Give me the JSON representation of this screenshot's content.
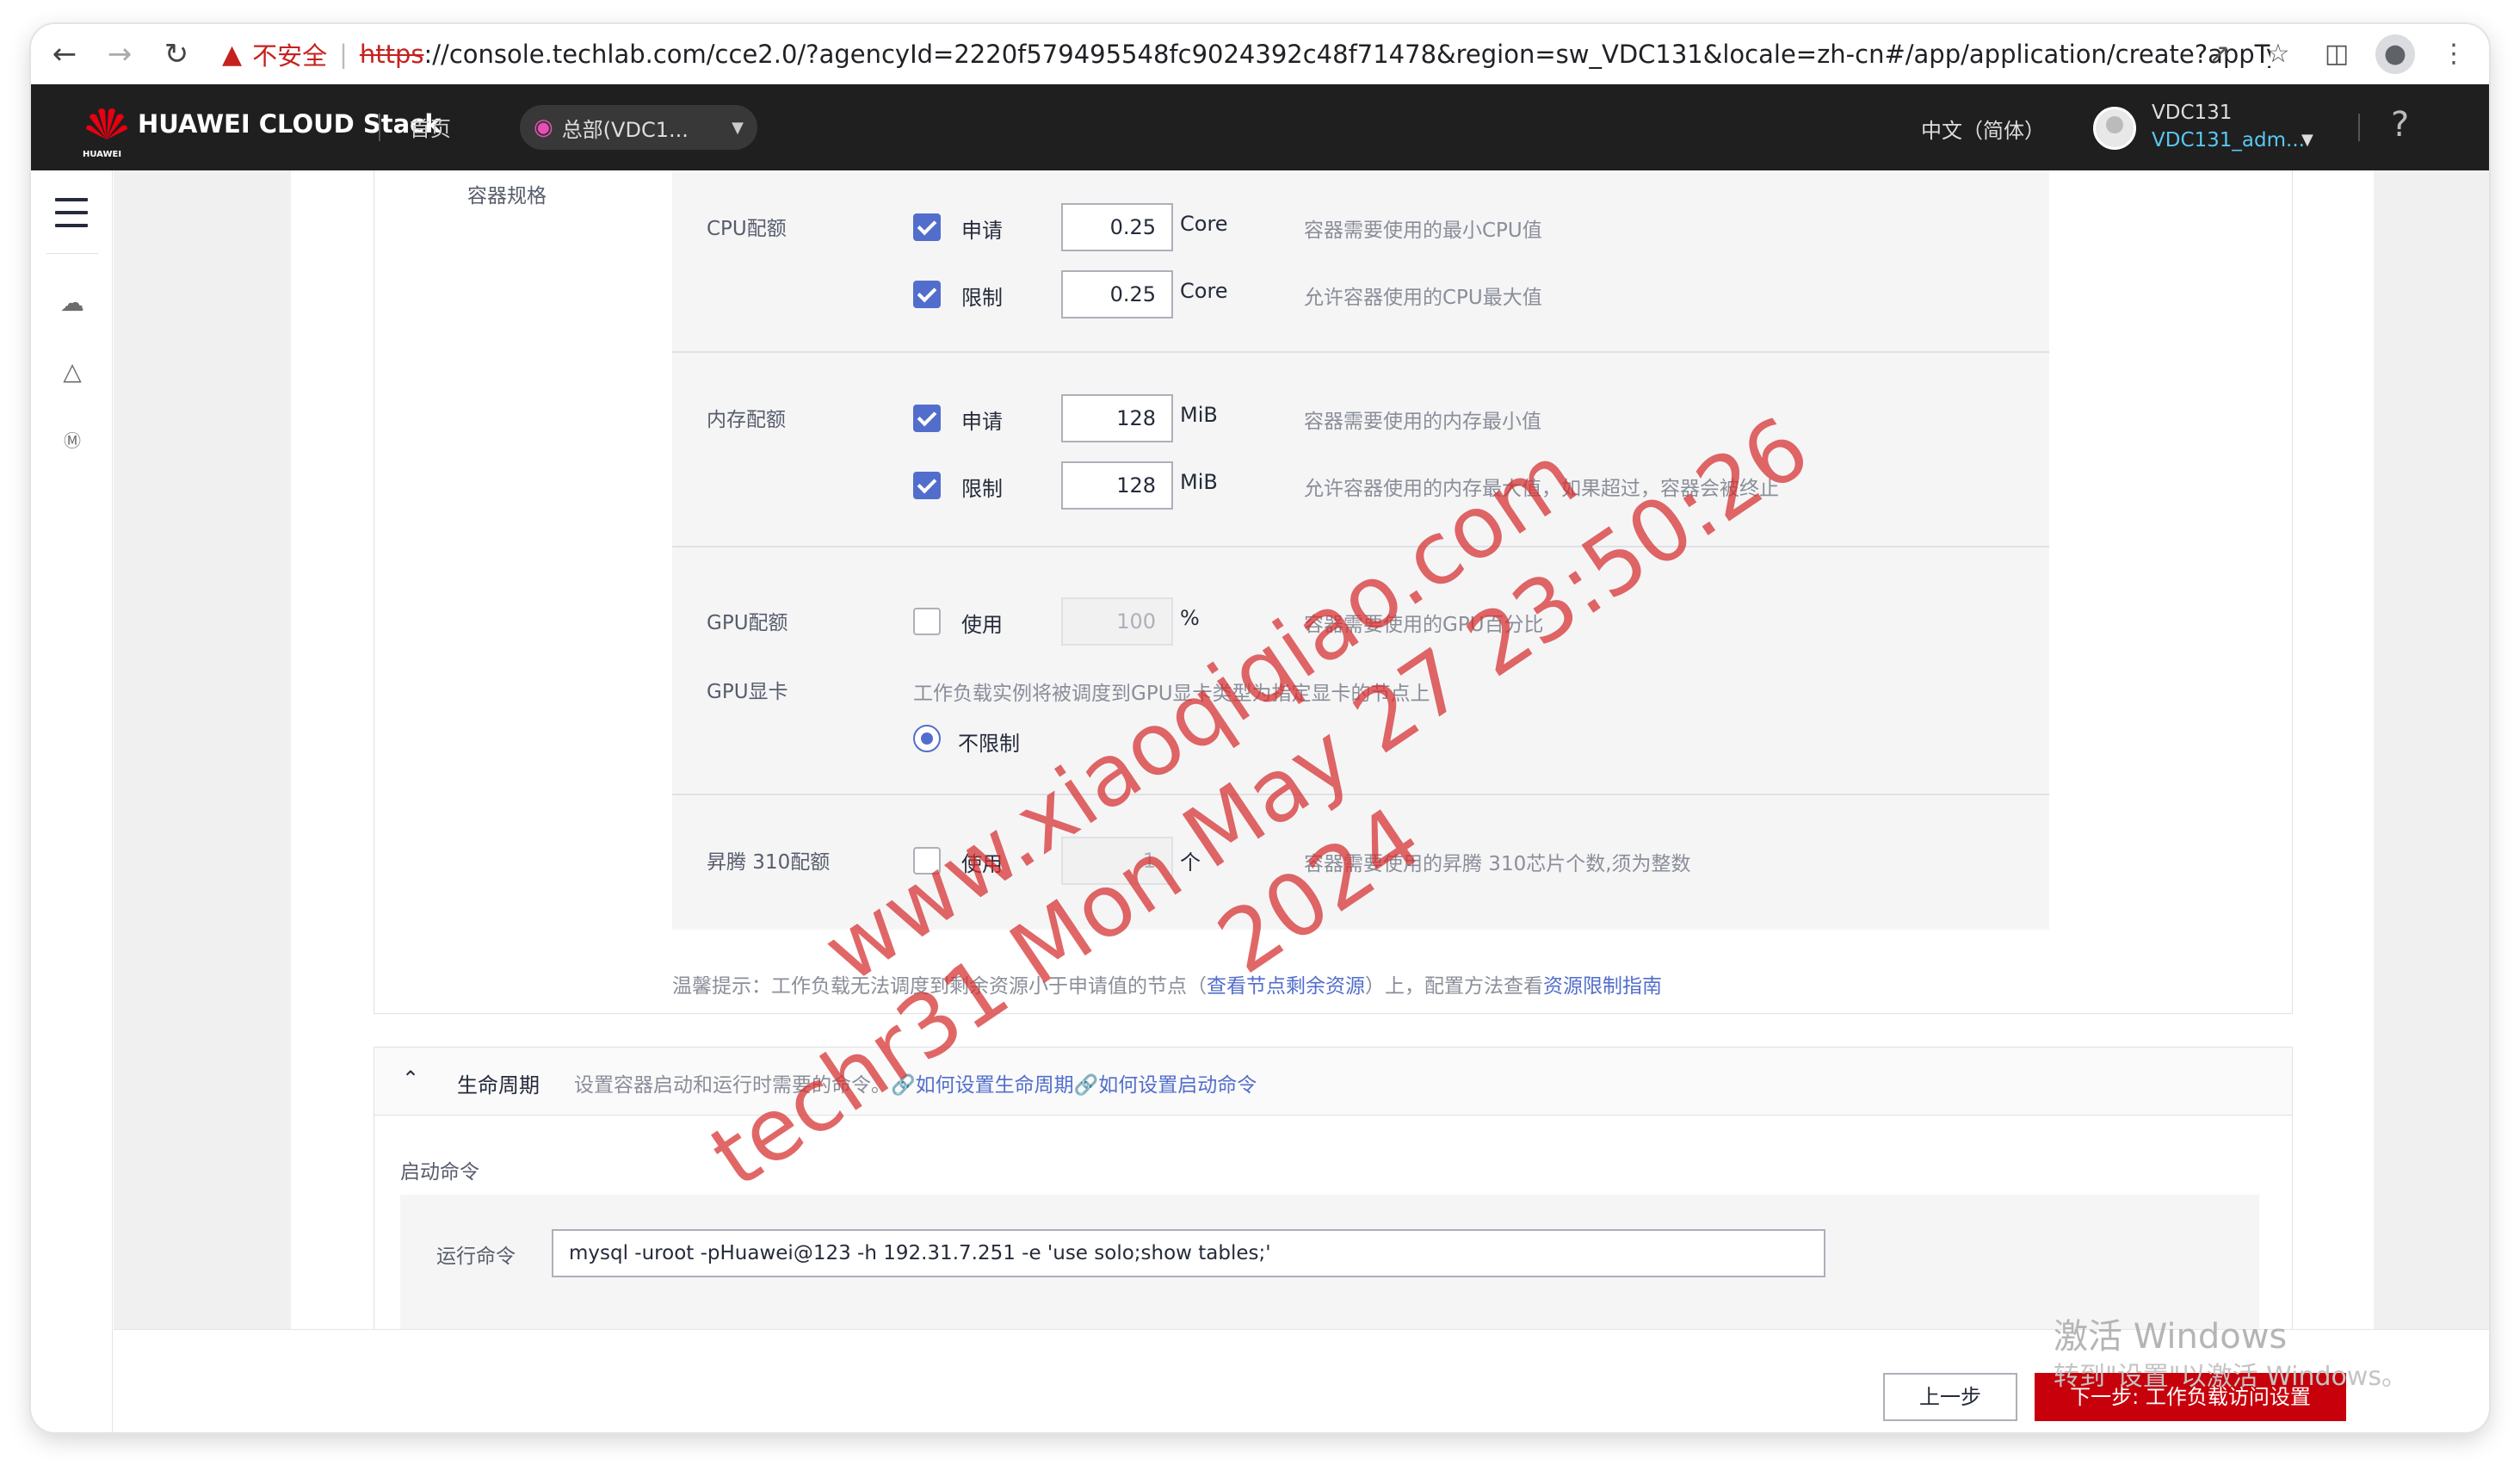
{
  "browser": {
    "insecure_label": "不安全",
    "url_scheme": "https",
    "url_rest": "://console.techlab.com/cce2.0/?agencyId=2220f579495548fc9024392c48f71478&region=sw_VDC131&locale=zh-cn#/app/application/create?appType..."
  },
  "topbar": {
    "brand_sub": "HUAWEI",
    "brand": "HUAWEI CLOUD Stack",
    "home": "首页",
    "region": "总部(VDC1...",
    "language": "中文（简体）",
    "user_name": "VDC131",
    "user_account": "VDC131_adm...",
    "help": "?"
  },
  "spec": {
    "section_label": "容器规格",
    "cpu": {
      "title": "CPU配额",
      "request_label": "申请",
      "request_value": "0.25",
      "limit_label": "限制",
      "limit_value": "0.25",
      "unit": "Core",
      "request_hint": "容器需要使用的最小CPU值",
      "limit_hint": "允许容器使用的CPU最大值"
    },
    "memory": {
      "title": "内存配额",
      "request_label": "申请",
      "request_value": "128",
      "limit_label": "限制",
      "limit_value": "128",
      "unit": "MiB",
      "request_hint": "容器需要使用的内存最小值",
      "limit_hint": "允许容器使用的内存最大值，如果超过，容器会被终止"
    },
    "gpu": {
      "title": "GPU配额",
      "use_label": "使用",
      "value": "100",
      "unit": "%",
      "hint": "容器需要使用的GPU百分比",
      "card_title": "GPU显卡",
      "card_desc": "工作负载实例将被调度到GPU显卡类型为指定显卡的节点上",
      "card_option": "不限制"
    },
    "ascend": {
      "title": "昇腾 310配额",
      "use_label": "使用",
      "value": "1",
      "unit": "个",
      "hint": "容器需要使用的昇腾 310芯片个数,须为整数"
    },
    "tip_prefix": "温馨提示：工作负载无法调度到剩余资源小于申请值的节点（",
    "tip_link1": "查看节点剩余资源",
    "tip_mid": "）上，配置方法查看",
    "tip_link2": "资源限制指南"
  },
  "lifecycle": {
    "title": "生命周期",
    "desc": "设置容器启动和运行时需要的命令。",
    "link1": "如何设置生命周期",
    "link2": "如何设置启动命令",
    "start_command_label": "启动命令",
    "run_command_label": "运行命令",
    "run_command_value": "mysql -uroot -pHuawei@123 -h 192.31.7.251 -e 'use solo;show tables;'"
  },
  "footer": {
    "prev": "上一步",
    "next": "下一步: 工作负载访问设置"
  },
  "os_overlay": {
    "line1": "激活 Windows",
    "line2": "转到\"设置\"以激活 Windows。"
  },
  "watermark": {
    "line1": "www.xiaoqiqiao.com",
    "line2": "techr31 Mon May 27 23:50:26 2024"
  }
}
